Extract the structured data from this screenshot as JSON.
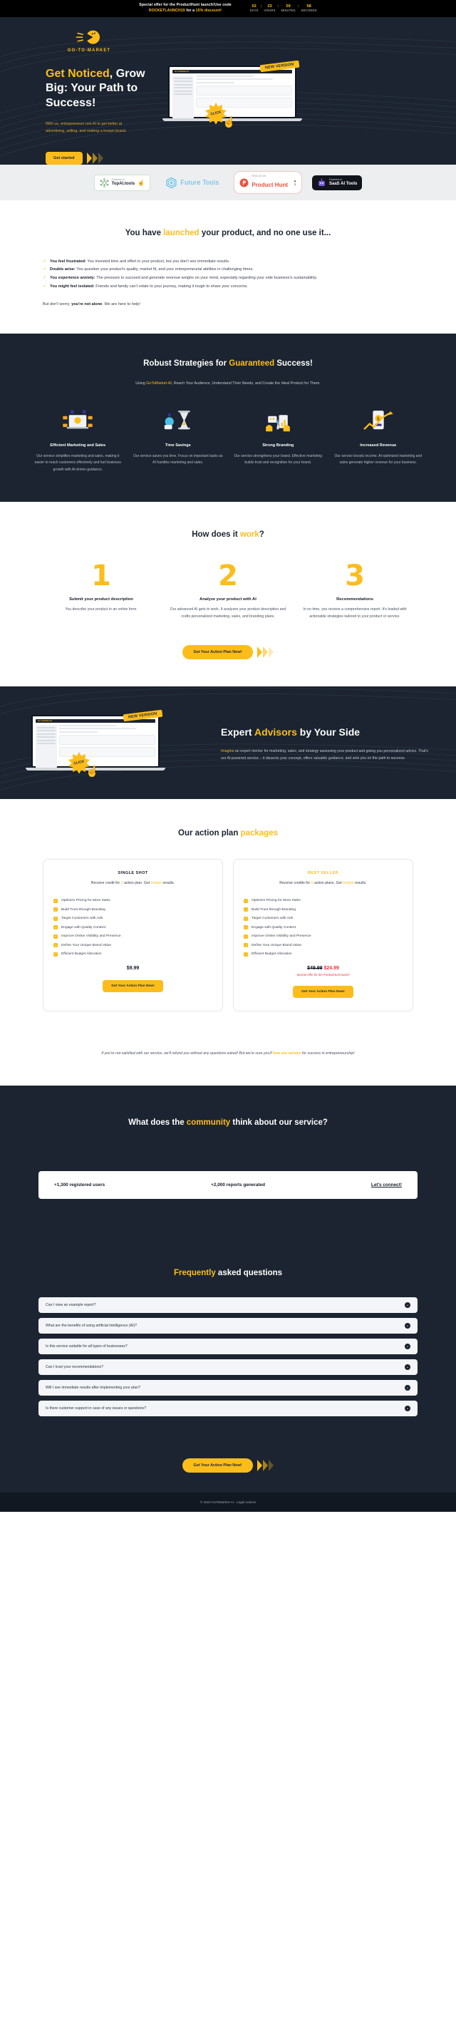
{
  "promo": {
    "line1": "Special offer for the ProductHunt launch!Use code",
    "code": "ROCKETLAUNCH15",
    "line2_mid": " for a ",
    "discount": "15% discount!",
    "countdown": {
      "days": {
        "value": "02",
        "label": "DAYS"
      },
      "hours": {
        "value": "23",
        "label": "HOURS"
      },
      "minutes": {
        "value": "59",
        "label": "MINUTES"
      },
      "seconds": {
        "value": "58",
        "label": "SECONDS"
      },
      "separator": ":"
    }
  },
  "brand": {
    "name": "GO-TO-MARKET"
  },
  "hero": {
    "title_accent": "Get Noticed",
    "title_rest": ", Grow Big: Your Path to Success!",
    "paragraph": "With us, entrepreneurs use AI to get better at advertising, selling, and making a known brand.",
    "cta": "Get started",
    "ribbon": "NEW VERSION",
    "badge": "CLICK",
    "mock_title": "Go-To-Market AI"
  },
  "logos": [
    {
      "sub": "Featured on",
      "name": "TopAI.tools",
      "icon": "network-icon"
    },
    {
      "name": "Future Tools",
      "icon": "hexagon-icon"
    },
    {
      "sub": "FIND US ON",
      "name": "Product Hunt",
      "votes_label": "▲",
      "votes": "1",
      "icon": "producthunt-icon"
    },
    {
      "sub": "Featured on",
      "name": "SaaS AI Tools",
      "icon": "robot-icon"
    }
  ],
  "launched": {
    "title_pre": "You have ",
    "title_accent": "launched",
    "title_post": " your product, and no one use it...",
    "bullets": [
      {
        "lead": "You feel frustrated:",
        "text": " You invested time and effort in your product, but you don't see immediate results."
      },
      {
        "lead": "Doubts arise:",
        "text": " You question your product's quality, market fit, and your entrepreneurial abilities in challenging times."
      },
      {
        "lead": "You experience anxiety:",
        "text": " The pressure to succeed and generate revenue weighs on your mind, especially regarding your side business's sustainability."
      },
      {
        "lead": "You might feel isolated:",
        "text": " Friends and family can't relate to your journey, making it tough to share your concerns."
      }
    ],
    "closing_pre": "But don't worry; ",
    "closing_bold": "you're not alone",
    "closing_post": ". We are here to help!"
  },
  "strategies": {
    "title_pre": "Robust Strategies for ",
    "title_accent": "Guaranteed",
    "title_post": " Success!",
    "sub_pre": "Using ",
    "sub_accent": "GoToMarket-AI",
    "sub_post": ", Reach Your Audience, Understand Their Needs, and Create the Ideal Product for Them.",
    "cards": [
      {
        "icon": "marketing-illustration",
        "title": "Efficient Marketing and Sales",
        "desc": "Our service simplifies marketing and sales, making it easier to reach customers effectively and fuel business growth with AI-driven guidance."
      },
      {
        "icon": "hourglass-illustration",
        "title": "Time Savings",
        "desc": "Our service saves you time. Focus on important tasks as AI handles marketing and sales."
      },
      {
        "icon": "rocket-illustration",
        "title": "Strong Branding",
        "desc": "Our service strengthens your brand. Effective marketing builds trust and recognition for your brand."
      },
      {
        "icon": "revenue-illustration",
        "title": "Increased Revenue",
        "desc": "Our service boosts income. AI-optimized marketing and sales generate higher revenue for your business."
      }
    ]
  },
  "how": {
    "title_pre": "How does it ",
    "title_accent": "work",
    "title_post": "?",
    "steps": [
      {
        "num": "1",
        "title": "Submit your product description",
        "desc": "You describe your product in an online form."
      },
      {
        "num": "2",
        "title": "Analyze your product with AI",
        "desc": "Our advanced AI gets to work. It analyzes your product description and crafts personalized marketing, sales, and branding plans."
      },
      {
        "num": "3",
        "title": "Recommendations",
        "desc": "In no time, you receive a comprehensive report. It's loaded with actionable strategies tailored to your product or service."
      }
    ],
    "cta": "Get Your Action Plan Now!"
  },
  "advisors": {
    "title_pre": "Expert ",
    "title_accent": "Advisors",
    "title_post": " by Your Side",
    "para_accent": "Imagine",
    "para_rest": " an expert mentor for marketing, sales, and strategy assessing your product and giving you personalized advice. That's our AI-powered service – it dissects your concept, offers valuable guidance, and sets you on the path to success.",
    "ribbon": "NEW VERSION",
    "badge": "CLICK",
    "mock_title": "Go-To-Market AI"
  },
  "pricing": {
    "title_pre": "Our action plan ",
    "title_accent": "packages",
    "plans": [
      {
        "tag": "SINGLE SHOT",
        "sub_pre": "Receive credit for ",
        "sub_count": "1",
        "sub_mid": " action plan. Get ",
        "sub_accent": "instant",
        "sub_post": " results.",
        "features": [
          "Optimize Pricing for More Sales",
          "Build Trust through Branding",
          "Target Customers with Ads",
          "Engage with Quality Content",
          "Improve Online Visibility and Presence",
          "Define Your Unique Brand Value",
          "Efficient Budget Allocation"
        ],
        "price": "$9.99",
        "cta": "Get Your Action Plan Now!"
      },
      {
        "tag": "BEST SELLER",
        "sub_pre": "Receive credits for ",
        "sub_count": "5",
        "sub_mid": " action plans. Get ",
        "sub_accent": "instant",
        "sub_post": " results.",
        "features": [
          "Optimize Pricing for More Sales",
          "Build Trust through Branding",
          "Target Customers with Ads",
          "Engage with Quality Content",
          "Improve Online Visibility and Presence",
          "Define Your Unique Brand Value",
          "Efficient Budget Allocation"
        ],
        "price_old": "$49.99",
        "price_new": "$24.99",
        "price_note": "Special offer for the ProductHunt launch",
        "cta": "Get Your Action Plan Now!"
      }
    ],
    "guarantee_pre": "If you're not satisfied with our service, we'll refund you without any questions asked! But we're sure you'll ",
    "guarantee_bold": "love our service",
    "guarantee_post": " for success in entrepreneurship!"
  },
  "community": {
    "title_pre": "What does the ",
    "title_accent": "community",
    "title_post": " think about our service?",
    "stats": [
      "+1,300 registered users",
      "+2,000 reports generated"
    ],
    "link": "Let's connect!"
  },
  "faq": {
    "title_accent": "Frequently",
    "title_post": " asked questions",
    "items": [
      "Can I view an example report?",
      "What are the benefits of using artificial intelligence (AI)?",
      "Is this service suitable for all types of businesses?",
      "Can I trust your recommendations?",
      "Will I see immediate results after implementing your plan?",
      "Is there customer support in case of any issues or questions?"
    ],
    "cta": "Get Your Action Plan Now!"
  },
  "footer": {
    "copyright": "© 2023 GoToMarket-AI · Legal notices"
  },
  "colors": {
    "accent": "#fcbd1b",
    "dark": "#1b2430",
    "red": "#ef3340"
  }
}
